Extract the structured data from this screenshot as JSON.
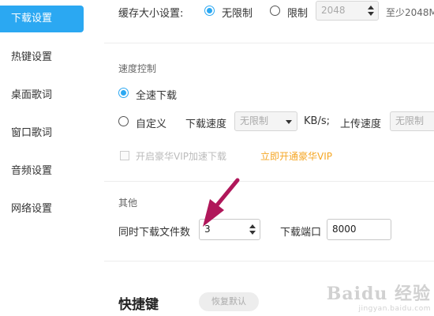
{
  "sidebar": {
    "items": [
      {
        "label": "下载设置",
        "active": true
      },
      {
        "label": "热键设置",
        "active": false
      },
      {
        "label": "桌面歌词",
        "active": false
      },
      {
        "label": "窗口歌词",
        "active": false
      },
      {
        "label": "音频设置",
        "active": false
      },
      {
        "label": "网络设置",
        "active": false
      }
    ]
  },
  "cache": {
    "label": "缓存大小设置:",
    "option_unlimited": "无限制",
    "option_limited": "限制",
    "selected": "无限制",
    "limit_value": "2048",
    "hint": "至少2048M"
  },
  "speed": {
    "section_title": "速度控制",
    "option_full": "全速下载",
    "option_custom": "自定义",
    "selected": "全速下载",
    "download_label": "下载速度",
    "download_value": "无限制",
    "unit": "KB/s;",
    "upload_label": "上传速度",
    "upload_value": "无限制",
    "vip_checkbox_label": "开启豪华VIP加速下载",
    "vip_link": "立即开通豪华VIP"
  },
  "other": {
    "section_title": "其他",
    "concurrent_label": "同时下载文件数",
    "concurrent_value": "3",
    "port_label": "下载端口",
    "port_value": "8000"
  },
  "hotkeys": {
    "title": "快捷键",
    "restore_label": "恢复默认"
  },
  "colors": {
    "accent": "#2ba8f2",
    "vip": "#f5a623",
    "arrow": "#b0175a"
  },
  "watermark": {
    "logo": "Baidu 经验",
    "url": "jingyan.baidu.com"
  }
}
